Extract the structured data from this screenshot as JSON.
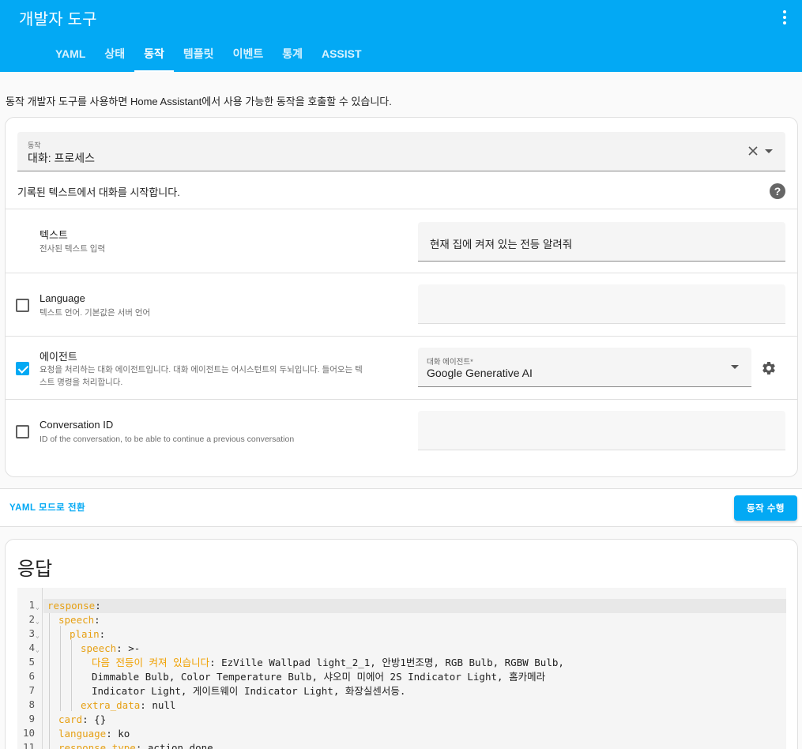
{
  "header": {
    "title": "개발자 도구",
    "tabs": [
      {
        "label": "YAML"
      },
      {
        "label": "상태"
      },
      {
        "label": "동작"
      },
      {
        "label": "템플릿"
      },
      {
        "label": "이벤트"
      },
      {
        "label": "통계"
      },
      {
        "label": "ASSIST"
      }
    ],
    "active_tab": "동작"
  },
  "description": "동작 개발자 도구를 사용하면 Home Assistant에서 사용 가능한 동작을 호출할 수 있습니다.",
  "action_card": {
    "action_label": "동작",
    "action_value": "대화: 프로세스",
    "action_description": "기록된 텍스트에서 대화를 시작합니다.",
    "help_icon": "question-circle-icon",
    "fields": {
      "text": {
        "name": "텍스트",
        "description": "전사된 텍스트 입력",
        "value": "현재 집에 켜져 있는 전등 알려줘"
      },
      "language": {
        "name": "Language",
        "description": "텍스트 언어. 기본값은 서버 언어",
        "checked": false,
        "value": ""
      },
      "agent": {
        "name": "에이전트",
        "description_line1": "요청을 처리하는 대화 에이전트입니다. 대화 에이전트는 어시스턴트의 두뇌입니다. 들어오는 텍",
        "description_line2": "스트 명령을 처리합니다.",
        "checked": true,
        "select_label": "대화 에이전트*",
        "select_value": "Google Generative AI"
      },
      "conversation_id": {
        "name": "Conversation ID",
        "description": "ID of the conversation, to be able to continue a previous conversation",
        "checked": false,
        "value": ""
      }
    }
  },
  "actions_bar": {
    "yaml_mode_label": "YAML 모드로 전환",
    "run_button_label": "동작 수행"
  },
  "response": {
    "title": "응답",
    "lines": [
      {
        "n": "1",
        "fold": true
      },
      {
        "n": "2",
        "fold": true
      },
      {
        "n": "3",
        "fold": true
      },
      {
        "n": "4",
        "fold": true
      },
      {
        "n": "5",
        "fold": false
      },
      {
        "n": "6",
        "fold": false
      },
      {
        "n": "7",
        "fold": false
      },
      {
        "n": "8",
        "fold": false
      },
      {
        "n": "9",
        "fold": false
      },
      {
        "n": "10",
        "fold": false
      },
      {
        "n": "11",
        "fold": false
      }
    ],
    "code": {
      "l1_key": "response",
      "l2_key": "speech",
      "l3_key": "plain",
      "l4_key": "speech",
      "l4_val": " >-",
      "l5_orange": "다음 전등이 켜져 있습니다",
      "l5_rest": ": EzVille Wallpad light_2_1, 안방1번조명, RGB Bulb, RGBW Bulb,",
      "l6": "Dimmable Bulb, Color Temperature Bulb, 샤오미 미에어 2S Indicator Light, 홈카메라",
      "l7": "Indicator Light, 게이트웨이 Indicator Light, 화장실센서등.",
      "l8_key": "extra_data",
      "l8_val": " null",
      "l9_key": "card",
      "l9_val": " {}",
      "l10_key": "language",
      "l10_val": " ko",
      "l11_key": "response_type",
      "l11_val": " action_done"
    }
  },
  "colors": {
    "primary": "#03a9f4",
    "yaml_key": "#e6a014"
  }
}
